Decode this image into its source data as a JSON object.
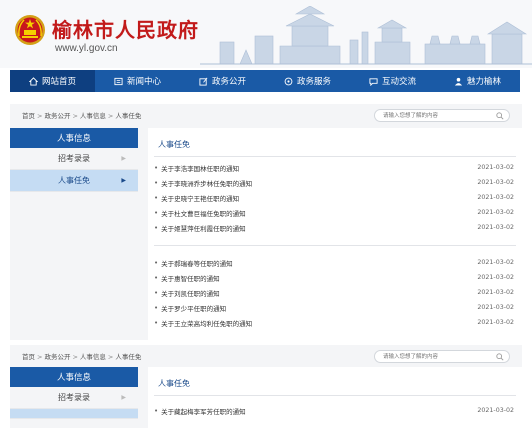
{
  "header": {
    "title": "榆林市人民政府",
    "url": "www.yl.gov.cn"
  },
  "nav": {
    "items": [
      {
        "label": "网站首页",
        "icon": "home-icon"
      },
      {
        "label": "新闻中心",
        "icon": "news-icon"
      },
      {
        "label": "政务公开",
        "icon": "edit-icon"
      },
      {
        "label": "政务服务",
        "icon": "service-icon"
      },
      {
        "label": "互动交流",
        "icon": "chat-icon"
      },
      {
        "label": "魅力榆林",
        "icon": "person-icon"
      }
    ],
    "active_index": 0
  },
  "breadcrumb": [
    "首页",
    "政务公开",
    "人事信息",
    "人事任免"
  ],
  "breadcrumb_sep": ">",
  "search": {
    "placeholder": "请输入您想了解的内容"
  },
  "sidebar": {
    "heading": "人事信息",
    "items": [
      {
        "label": "招考录录",
        "active": false
      },
      {
        "label": "人事任免",
        "active": true
      }
    ]
  },
  "content": {
    "title": "人事任免",
    "group1": [
      {
        "title": "关于李浩李国林任职的通知",
        "date": "2021-03-02"
      },
      {
        "title": "关于李晓洲乔步林任免职的通知",
        "date": "2021-03-02"
      },
      {
        "title": "关于史晓宁王艳任职的通知",
        "date": "2021-03-02"
      },
      {
        "title": "关于杜文曹巨福任免职的通知",
        "date": "2021-03-02"
      },
      {
        "title": "关于姬慧萍任利霞任职的通知",
        "date": "2021-03-02"
      }
    ],
    "group2": [
      {
        "title": "关于郝瑞春等任职的通知",
        "date": "2021-03-02"
      },
      {
        "title": "关于惠智任职的通知",
        "date": "2021-03-02"
      },
      {
        "title": "关于刘凯任职的通知",
        "date": "2021-03-02"
      },
      {
        "title": "关于罗少平任职的通知",
        "date": "2021-03-02"
      },
      {
        "title": "关于王立荣高均利任免职的通知",
        "date": "2021-03-02"
      }
    ],
    "group3": [
      {
        "title": "关于藏起梅李军芳任职的通知",
        "date": "2021-03-02"
      }
    ]
  },
  "colors": {
    "primary": "#1a5aa6",
    "title_red": "#c21a1a",
    "active_side": "#c5dcf3"
  }
}
